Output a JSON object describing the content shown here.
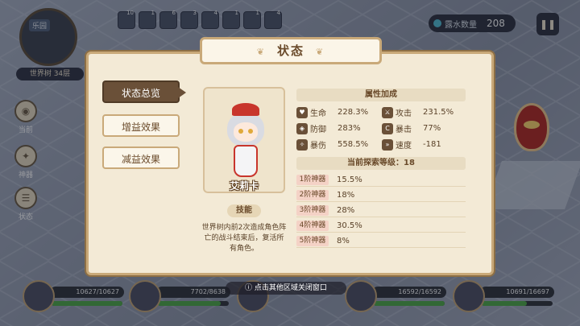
{
  "hud": {
    "minimap_tag": "乐园",
    "world_level": "世界树 34层",
    "top_items": [
      {
        "count": "10"
      },
      {
        "count": "1"
      },
      {
        "count": "6"
      },
      {
        "count": "3"
      },
      {
        "count": "4"
      },
      {
        "count": "1"
      },
      {
        "count": "1"
      },
      {
        "count": "4"
      }
    ],
    "water_label": "露水数量",
    "water_value": "208",
    "pause_icon": "pause-icon",
    "side_buttons": [
      {
        "label": "当前",
        "icon": "location-icon"
      },
      {
        "label": "神器",
        "icon": "star-icon"
      },
      {
        "label": "状态",
        "icon": "status-icon"
      }
    ],
    "hint": "点击其他区域关闭窗口"
  },
  "team": [
    {
      "hp": "10627/10627",
      "fill": 1.0
    },
    {
      "hp": "7702/8638",
      "fill": 0.89
    },
    {
      "hp": "",
      "fill": 0.0
    },
    {
      "hp": "16592/16592",
      "fill": 1.0
    },
    {
      "hp": "10691/16697",
      "fill": 0.64
    }
  ],
  "modal": {
    "title": "状态",
    "tabs": [
      "状态总览",
      "增益效果",
      "减益效果"
    ],
    "character_name": "艾莉卡",
    "skill_label": "技能",
    "skill_desc": "世界树内前2次造成角色阵亡的战斗结束后，复活所有角色。",
    "attr_header": "属性加成",
    "attributes": [
      {
        "name": "生命",
        "value": "228.3%",
        "icon": "heart-icon"
      },
      {
        "name": "攻击",
        "value": "231.5%",
        "icon": "sword-icon"
      },
      {
        "name": "防御",
        "value": "283%",
        "icon": "shield-icon"
      },
      {
        "name": "暴击",
        "value": "77%",
        "icon": "crit-icon"
      },
      {
        "name": "暴伤",
        "value": "558.5%",
        "icon": "crit-damage-icon"
      },
      {
        "name": "速度",
        "value": "-181",
        "icon": "boot-icon"
      }
    ],
    "explore_header": "当前探索等级：",
    "explore_level": "18",
    "artifacts": [
      {
        "tier": "1阶神器",
        "pct": "15.5%"
      },
      {
        "tier": "2阶神器",
        "pct": "18%"
      },
      {
        "tier": "3阶神器",
        "pct": "28%"
      },
      {
        "tier": "4阶神器",
        "pct": "30.5%"
      },
      {
        "tier": "5阶神器",
        "pct": "8%"
      }
    ]
  }
}
